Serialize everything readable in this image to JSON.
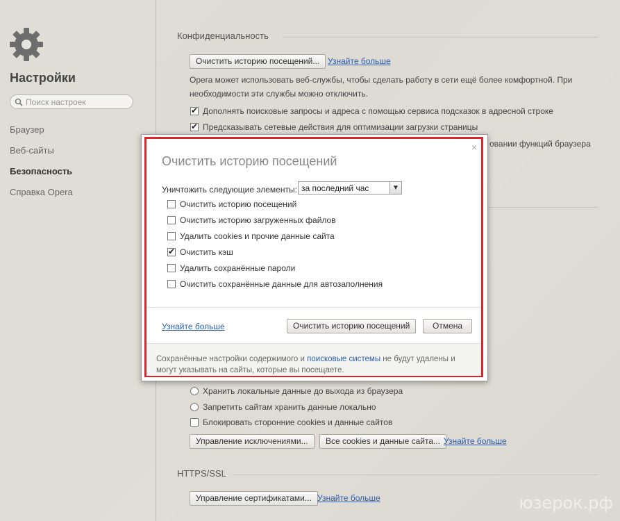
{
  "sidebar": {
    "title": "Настройки",
    "search_placeholder": "Поиск настроек",
    "items": [
      {
        "label": "Браузер"
      },
      {
        "label": "Веб-сайты"
      },
      {
        "label": "Безопасность"
      },
      {
        "label": "Справка Opera"
      }
    ]
  },
  "privacy": {
    "title": "Конфиденциальность",
    "clear_button": "Очистить историю посещений...",
    "learn_more": "Узнайте больше",
    "info_line1": "Opera может использовать веб-службы, чтобы сделать работу в сети ещё более комфортной. При",
    "info_line2": "необходимости эти службы можно отключить.",
    "options": [
      {
        "label": "Дополнять поисковые запросы и адреса с помощью сервиса подсказок в адресной строке",
        "checked": true
      },
      {
        "label": "Предсказывать сетевые действия для оптимизации загрузки страницы",
        "checked": true
      }
    ],
    "partial_text": "овании функций браузера"
  },
  "cookies": {
    "options": [
      {
        "label": "Хранить локальные данные до выхода из браузера"
      },
      {
        "label": "Запретить сайтам хранить данные локально"
      }
    ],
    "block_third_party": "Блокировать сторонние cookies и данные сайтов",
    "manage_exceptions": "Управление исключениями...",
    "all_cookies": "Все cookies и данные сайта...",
    "learn_more": "Узнайте больше"
  },
  "https": {
    "title": "HTTPS/SSL",
    "manage_certs": "Управление сертификатами...",
    "learn_more": "Узнайте больше"
  },
  "dialog": {
    "title": "Очистить историю посещений",
    "close": "×",
    "select_label": "Уничтожить следующие элементы:",
    "select_value": "за последний час",
    "checkboxes": [
      {
        "label": "Очистить историю посещений",
        "checked": false
      },
      {
        "label": "Очистить историю загруженных файлов",
        "checked": false
      },
      {
        "label": "Удалить cookies и прочие данные сайта",
        "checked": false
      },
      {
        "label": "Очистить кэш",
        "checked": true
      },
      {
        "label": "Удалить сохранённые пароли",
        "checked": false
      },
      {
        "label": "Очистить сохранённые данные для автозаполнения",
        "checked": false
      }
    ],
    "learn_more": "Узнайте больше",
    "confirm_button": "Очистить историю посещений",
    "cancel_button": "Отмена",
    "note_before": "Сохранённые настройки содержимого и ",
    "note_link": "поисковые системы",
    "note_after": " не будут удалены и могут указывать на сайты, которые вы посещаете."
  },
  "watermark": "юзерок.рф"
}
